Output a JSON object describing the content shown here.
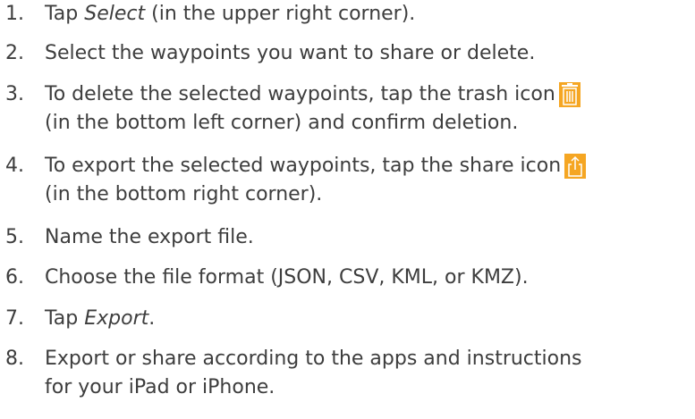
{
  "steps": [
    {
      "num": "1.",
      "pre": "Tap ",
      "em": "Select",
      "post": " (in the upper right corner)."
    },
    {
      "num": "2.",
      "text": "Select the waypoints you want to share or delete."
    },
    {
      "num": "3.",
      "line1": "To delete the selected waypoints, tap the trash icon",
      "line2": "(in the bottom left corner) and confirm deletion.",
      "icon": "trash-icon"
    },
    {
      "num": "4.",
      "line1": "To export the selected waypoints, tap the share icon",
      "line2": "(in the bottom right corner).",
      "icon": "share-icon"
    },
    {
      "num": "5.",
      "text": "Name the export file."
    },
    {
      "num": "6.",
      "text": "Choose the file format (JSON, CSV, KML, or KMZ)."
    },
    {
      "num": "7.",
      "pre": "Tap ",
      "em": "Export",
      "post": "."
    },
    {
      "num": "8.",
      "line1": "Export or share according to the apps and instructions",
      "line2": "for your iPad or iPhone."
    }
  ],
  "colors": {
    "text": "#3d3d3d",
    "icon_accent": "#f5a623"
  }
}
